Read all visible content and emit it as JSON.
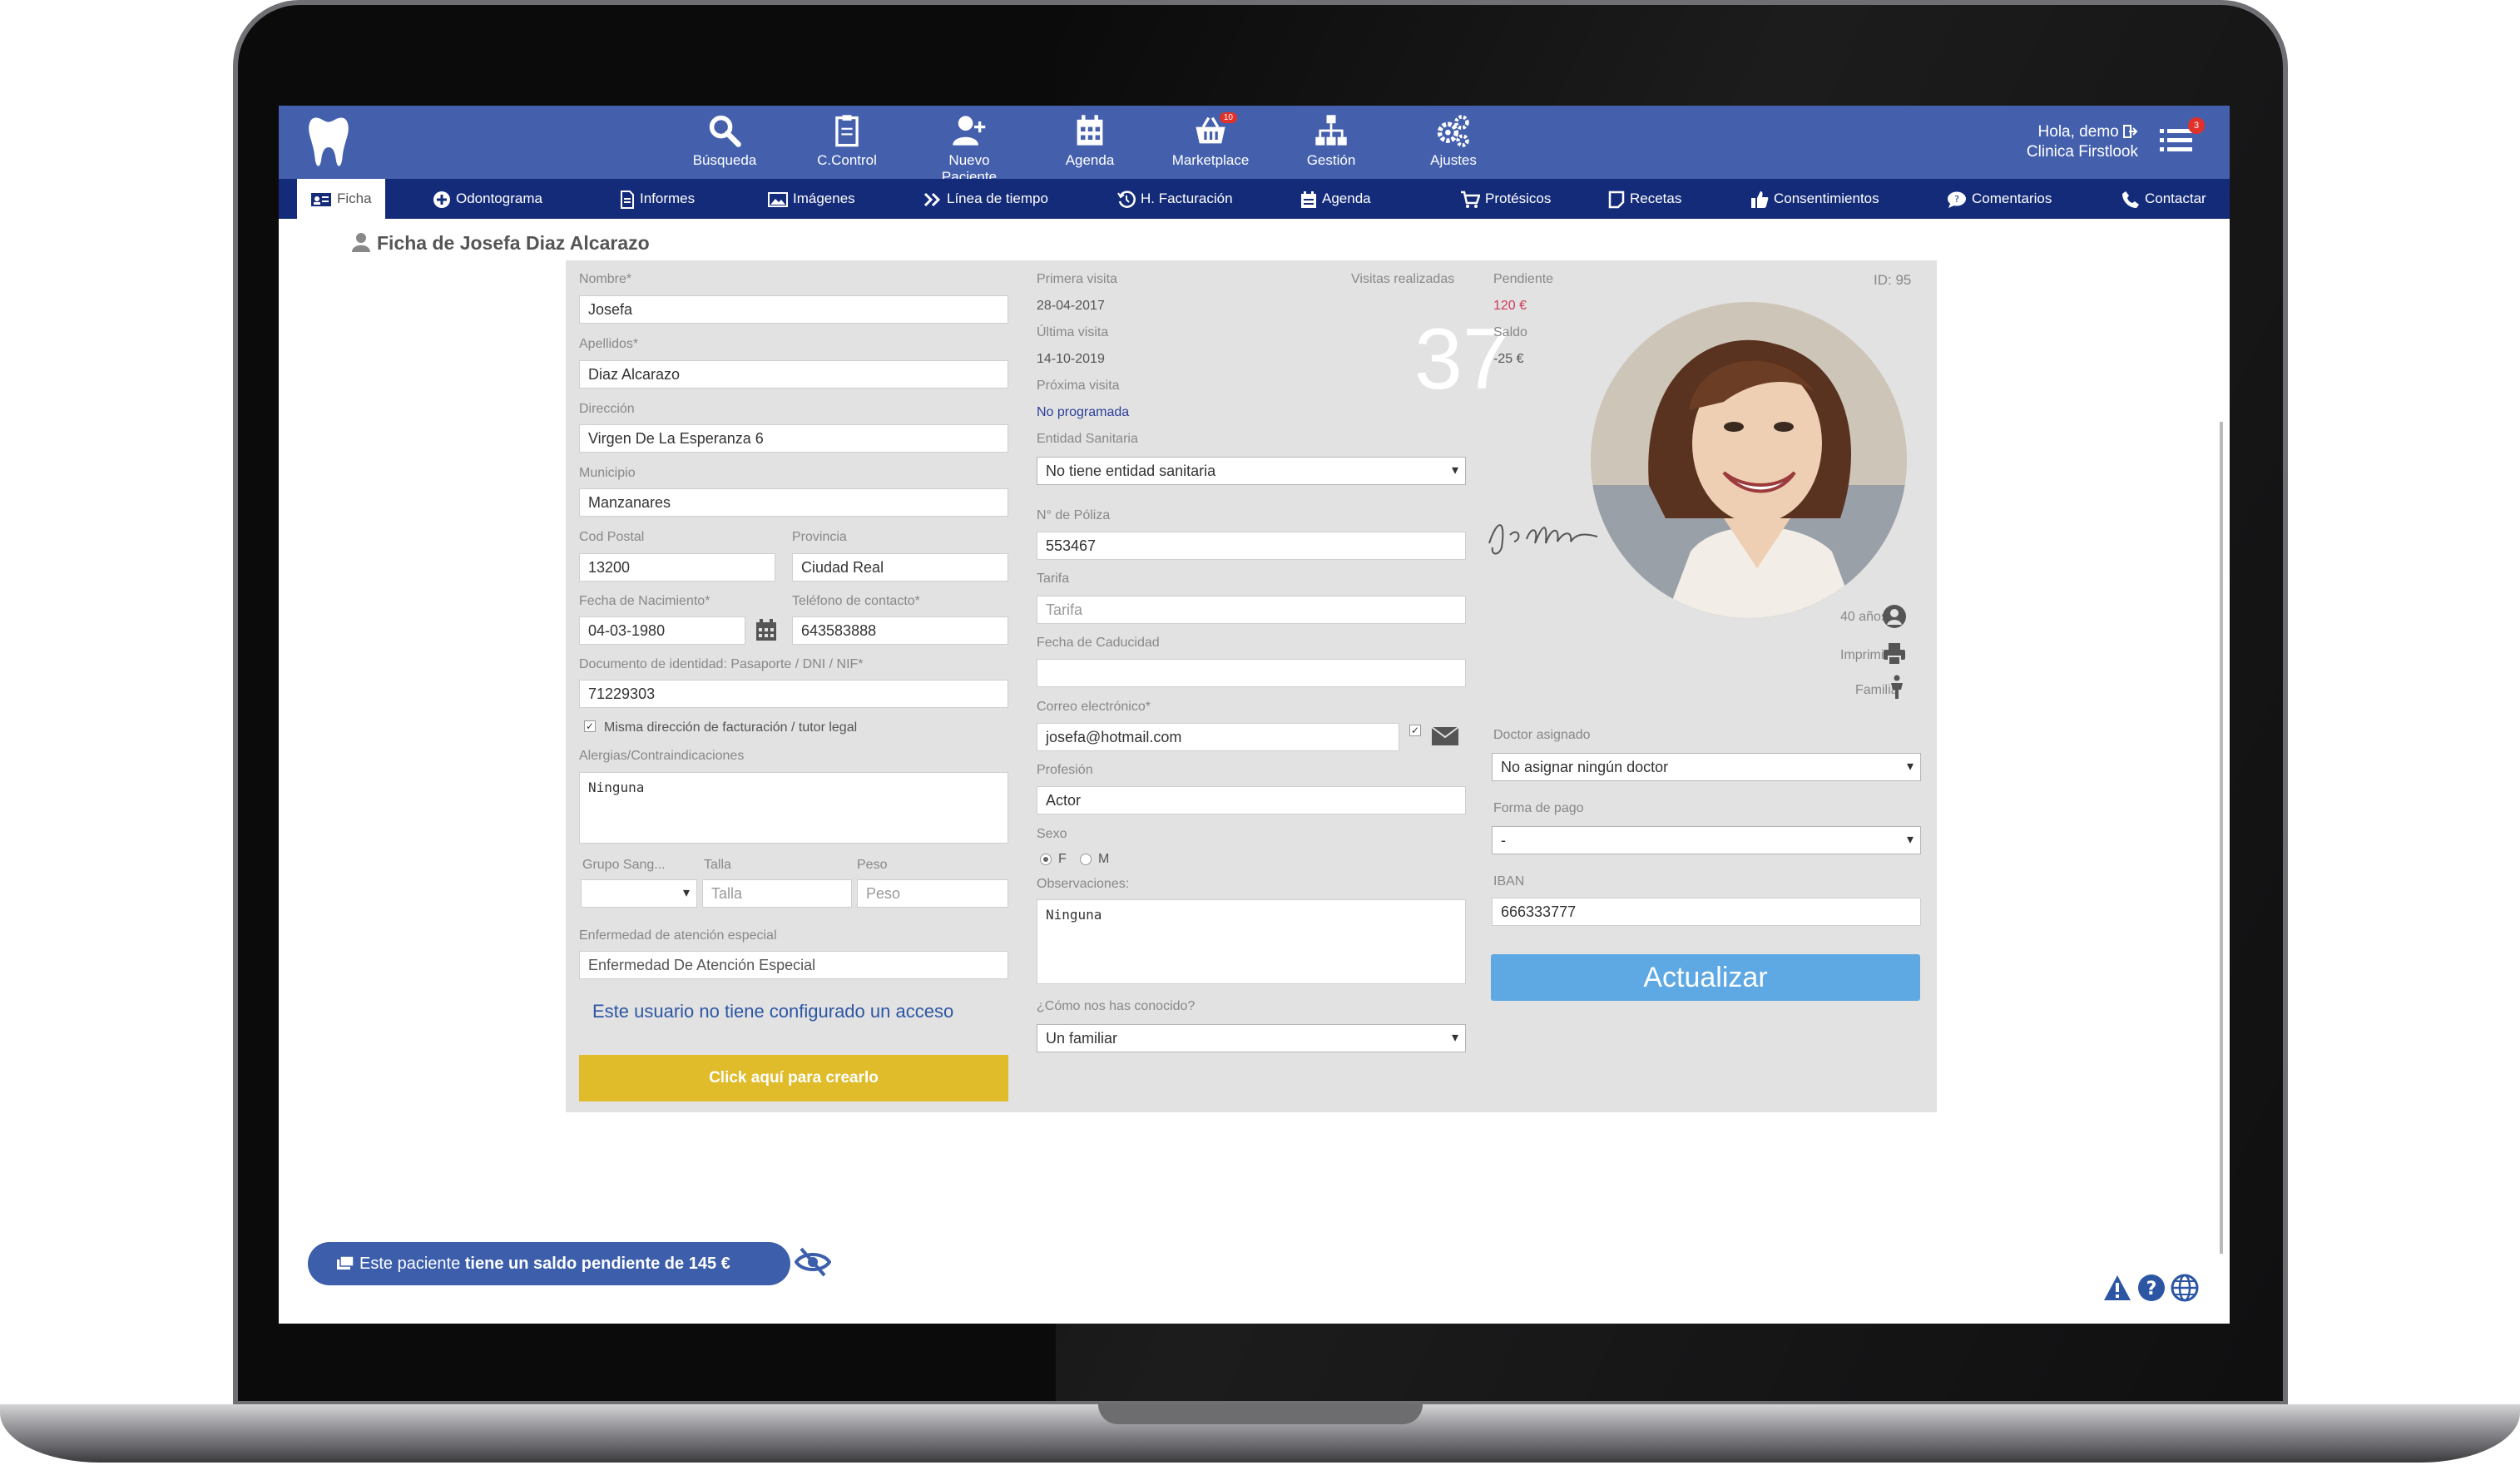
{
  "topbar": {
    "nav": [
      {
        "label": "Búsqueda",
        "icon": "search-icon"
      },
      {
        "label": "C.Control",
        "icon": "clipboard-icon"
      },
      {
        "label": "Nuevo Paciente",
        "icon": "add-user-icon"
      },
      {
        "label": "Agenda",
        "icon": "calendar-icon"
      },
      {
        "label": "Marketplace",
        "icon": "basket-icon",
        "badge": "10"
      },
      {
        "label": "Gestión",
        "icon": "sitemap-icon"
      },
      {
        "label": "Ajustes",
        "icon": "cogs-icon"
      }
    ],
    "greeting": "Hola, demo",
    "clinic": "Clinica Firstlook",
    "menu_badge": "3"
  },
  "tabs": [
    {
      "label": "Ficha",
      "icon": "id-card-icon"
    },
    {
      "label": "Odontograma",
      "icon": "plus-circle-icon"
    },
    {
      "label": "Informes",
      "icon": "document-icon"
    },
    {
      "label": "Imágenes",
      "icon": "image-icon"
    },
    {
      "label": "Línea de tiempo",
      "icon": "chevrons-right-icon"
    },
    {
      "label": "H. Facturación",
      "icon": "history-icon"
    },
    {
      "label": "Agenda",
      "icon": "calendar-icon"
    },
    {
      "label": "Protésicos",
      "icon": "cart-icon"
    },
    {
      "label": "Recetas",
      "icon": "note-icon"
    },
    {
      "label": "Consentimientos",
      "icon": "thumbs-up-icon"
    },
    {
      "label": "Comentarios",
      "icon": "comment-icon"
    },
    {
      "label": "Contactar",
      "icon": "phone-icon"
    }
  ],
  "page_title": "Ficha de Josefa Diaz Alcarazo",
  "left": {
    "nombre_label": "Nombre*",
    "nombre": "Josefa",
    "apellidos_label": "Apellidos*",
    "apellidos": "Diaz Alcarazo",
    "direccion_label": "Dirección",
    "direccion": "Virgen De La Esperanza 6",
    "municipio_label": "Municipio",
    "municipio": "Manzanares",
    "cp_label": "Cod Postal",
    "cp": "13200",
    "provincia_label": "Provincia",
    "provincia": "Ciudad Real",
    "nacimiento_label": "Fecha de Nacimiento*",
    "nacimiento": "04-03-1980",
    "telefono_label": "Teléfono de contacto*",
    "telefono": "643583888",
    "documento_label": "Documento de identidad: Pasaporte / DNI / NIF*",
    "documento": "71229303",
    "misma_direccion": "Misma dirección de facturación / tutor legal",
    "alergias_label": "Alergias/Contraindicaciones",
    "alergias": "Ninguna",
    "grupo_label": "Grupo Sang...",
    "talla_label": "Talla",
    "talla_ph": "Talla",
    "peso_label": "Peso",
    "peso_ph": "Peso",
    "enfermedad_label": "Enfermedad de atención especial",
    "enfermedad_ph": "Enfermedad De Atención Especial",
    "access_note": "Este usuario no tiene configurado un acceso",
    "create_button": "Click aquí para crearlo"
  },
  "middle": {
    "primera_label": "Primera visita",
    "primera": "28-04-2017",
    "ultima_label": "Última visita",
    "ultima": "14-10-2019",
    "proxima_label": "Próxima visita",
    "proxima": "No programada",
    "visitas_label": "Visitas realizadas",
    "visitas": "37",
    "entidad_label": "Entidad Sanitaria",
    "entidad": "No tiene entidad sanitaria",
    "poliza_label": "N° de Póliza",
    "poliza": "553467",
    "tarifa_label": "Tarifa",
    "tarifa_ph": "Tarifa",
    "caducidad_label": "Fecha de Caducidad",
    "correo_label": "Correo electrónico*",
    "correo": "josefa@hotmail.com",
    "profesion_label": "Profesión",
    "profesion": "Actor",
    "sexo_label": "Sexo",
    "sexo_f": "F",
    "sexo_m": "M",
    "observaciones_label": "Observaciones:",
    "observaciones": "Ninguna",
    "conocido_label": "¿Cómo nos has conocido?",
    "conocido": "Un familiar"
  },
  "right": {
    "pendiente_label": "Pendiente",
    "pendiente": "120 €",
    "saldo_label": "Saldo",
    "saldo": "-25 €",
    "id": "ID: 95",
    "edad": "40 años",
    "imprimir": "Imprimir",
    "familia": "Familia",
    "doctor_label": "Doctor asignado",
    "doctor": "No asignar ningún doctor",
    "pago_label": "Forma de pago",
    "pago": "-",
    "iban_label": "IBAN",
    "iban": "666333777",
    "update_button": "Actualizar"
  },
  "footer": {
    "pending_prefix": "Este paciente",
    "pending_strong": "tiene un saldo pendiente de 145 €"
  },
  "colors": {
    "topbar": "#4460ad",
    "tabbar": "#142b7a",
    "update": "#5ea8e3",
    "create": "#e0bb2a",
    "pending": "#cc3a5a"
  }
}
